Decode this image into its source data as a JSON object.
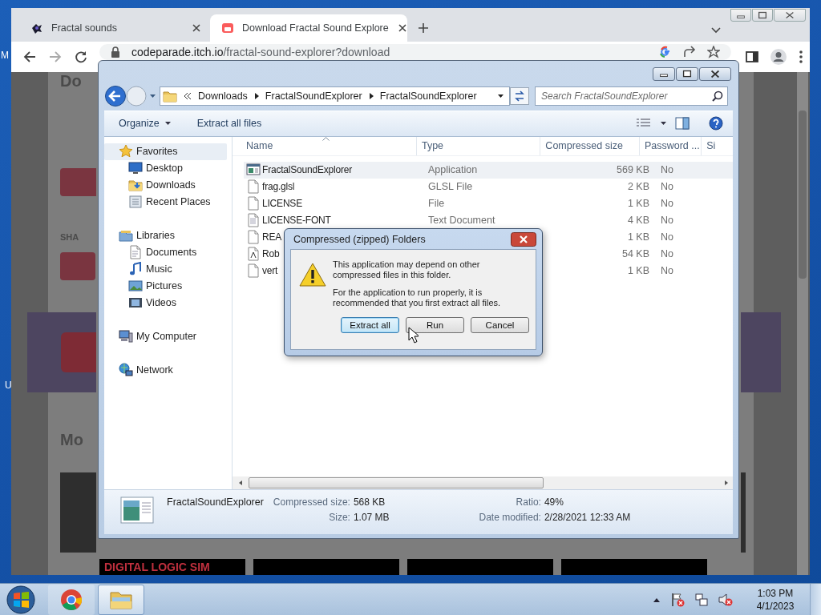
{
  "desktop": {
    "fragments": [
      "M",
      "U"
    ]
  },
  "browser": {
    "tabs": [
      {
        "title": "Fractal sounds",
        "selected": false
      },
      {
        "title": "Download Fractal Sound Explore",
        "selected": true
      }
    ],
    "address": "codeparade.itch.io/fractal-sound-explorer?download",
    "page_fragments": [
      "Do",
      "SHA",
      "Mo",
      "DIGITAL LOGIC SIM"
    ]
  },
  "explorer": {
    "breadcrumb": [
      "Downloads",
      "FractalSoundExplorer",
      "FractalSoundExplorer"
    ],
    "search": {
      "placeholder": "Search FractalSoundExplorer"
    },
    "commands": [
      {
        "label": "Organize",
        "dropdown": true
      },
      {
        "label": "Extract all files",
        "dropdown": false
      }
    ],
    "nav": [
      {
        "label": "Favorites",
        "kind": "star",
        "selected": true,
        "children": [
          {
            "label": "Desktop",
            "kind": "desktop",
            "selected": false
          },
          {
            "label": "Downloads",
            "kind": "downloads",
            "selected": false
          },
          {
            "label": "Recent Places",
            "kind": "recent",
            "selected": false
          }
        ]
      },
      {
        "label": "Libraries",
        "kind": "library",
        "selected": false,
        "children": [
          {
            "label": "Documents",
            "kind": "document",
            "selected": false
          },
          {
            "label": "Music",
            "kind": "music",
            "selected": false
          },
          {
            "label": "Pictures",
            "kind": "picture",
            "selected": false
          },
          {
            "label": "Videos",
            "kind": "video",
            "selected": false
          }
        ]
      },
      {
        "label": "My Computer",
        "kind": "computer",
        "selected": false
      },
      {
        "label": "Network",
        "kind": "network",
        "selected": false
      }
    ],
    "columns": [
      {
        "label": "Name",
        "sorted": true
      },
      {
        "label": "Type",
        "sorted": false
      },
      {
        "label": "Compressed size",
        "sorted": false
      },
      {
        "label": "Password ...",
        "sorted": false
      },
      {
        "label": "Si",
        "sorted": false
      }
    ],
    "rows": [
      {
        "kind": "app",
        "name": "FractalSoundExplorer",
        "type": "Application",
        "size": "569 KB",
        "password": "No",
        "selected": true
      },
      {
        "kind": "file",
        "name": "frag.glsl",
        "type": "GLSL File",
        "size": "2 KB",
        "password": "No",
        "selected": false
      },
      {
        "kind": "file",
        "name": "LICENSE",
        "type": "File",
        "size": "1 KB",
        "password": "No",
        "selected": false
      },
      {
        "kind": "text",
        "name": "LICENSE-FONT",
        "type": "Text Document",
        "size": "4 KB",
        "password": "No",
        "selected": false
      },
      {
        "kind": "file",
        "name": "REA",
        "size": "1 KB",
        "password": "No",
        "selected": false
      },
      {
        "kind": "font",
        "name": "Rob",
        "size": "54 KB",
        "password": "No",
        "selected": false
      },
      {
        "kind": "file",
        "name": "vert",
        "size": "1 KB",
        "password": "No",
        "selected": false
      }
    ],
    "details": {
      "name": "FractalSoundExplorer",
      "fields": [
        {
          "label": "Compressed size:",
          "value": "568 KB"
        },
        {
          "label": "Ratio:",
          "value": "49%"
        },
        {
          "label": "Size:",
          "value": "1.07 MB"
        },
        {
          "label": "Date modified:",
          "value": "2/28/2021 12:33 AM"
        }
      ]
    }
  },
  "dialog": {
    "title": "Compressed (zipped) Folders",
    "messages": [
      "This application may depend on other compressed files in this folder.",
      "For the application to run properly, it is recommended that you first extract all files."
    ],
    "buttons": [
      {
        "label": "Extract all",
        "default": true
      },
      {
        "label": "Run",
        "default": false
      },
      {
        "label": "Cancel",
        "default": false
      }
    ]
  },
  "taskbar": {
    "apps": [
      {
        "kind": "chrome",
        "selected": false
      },
      {
        "kind": "explorer",
        "selected": true
      }
    ],
    "time": "1:03 PM",
    "date": "4/1/2023"
  }
}
